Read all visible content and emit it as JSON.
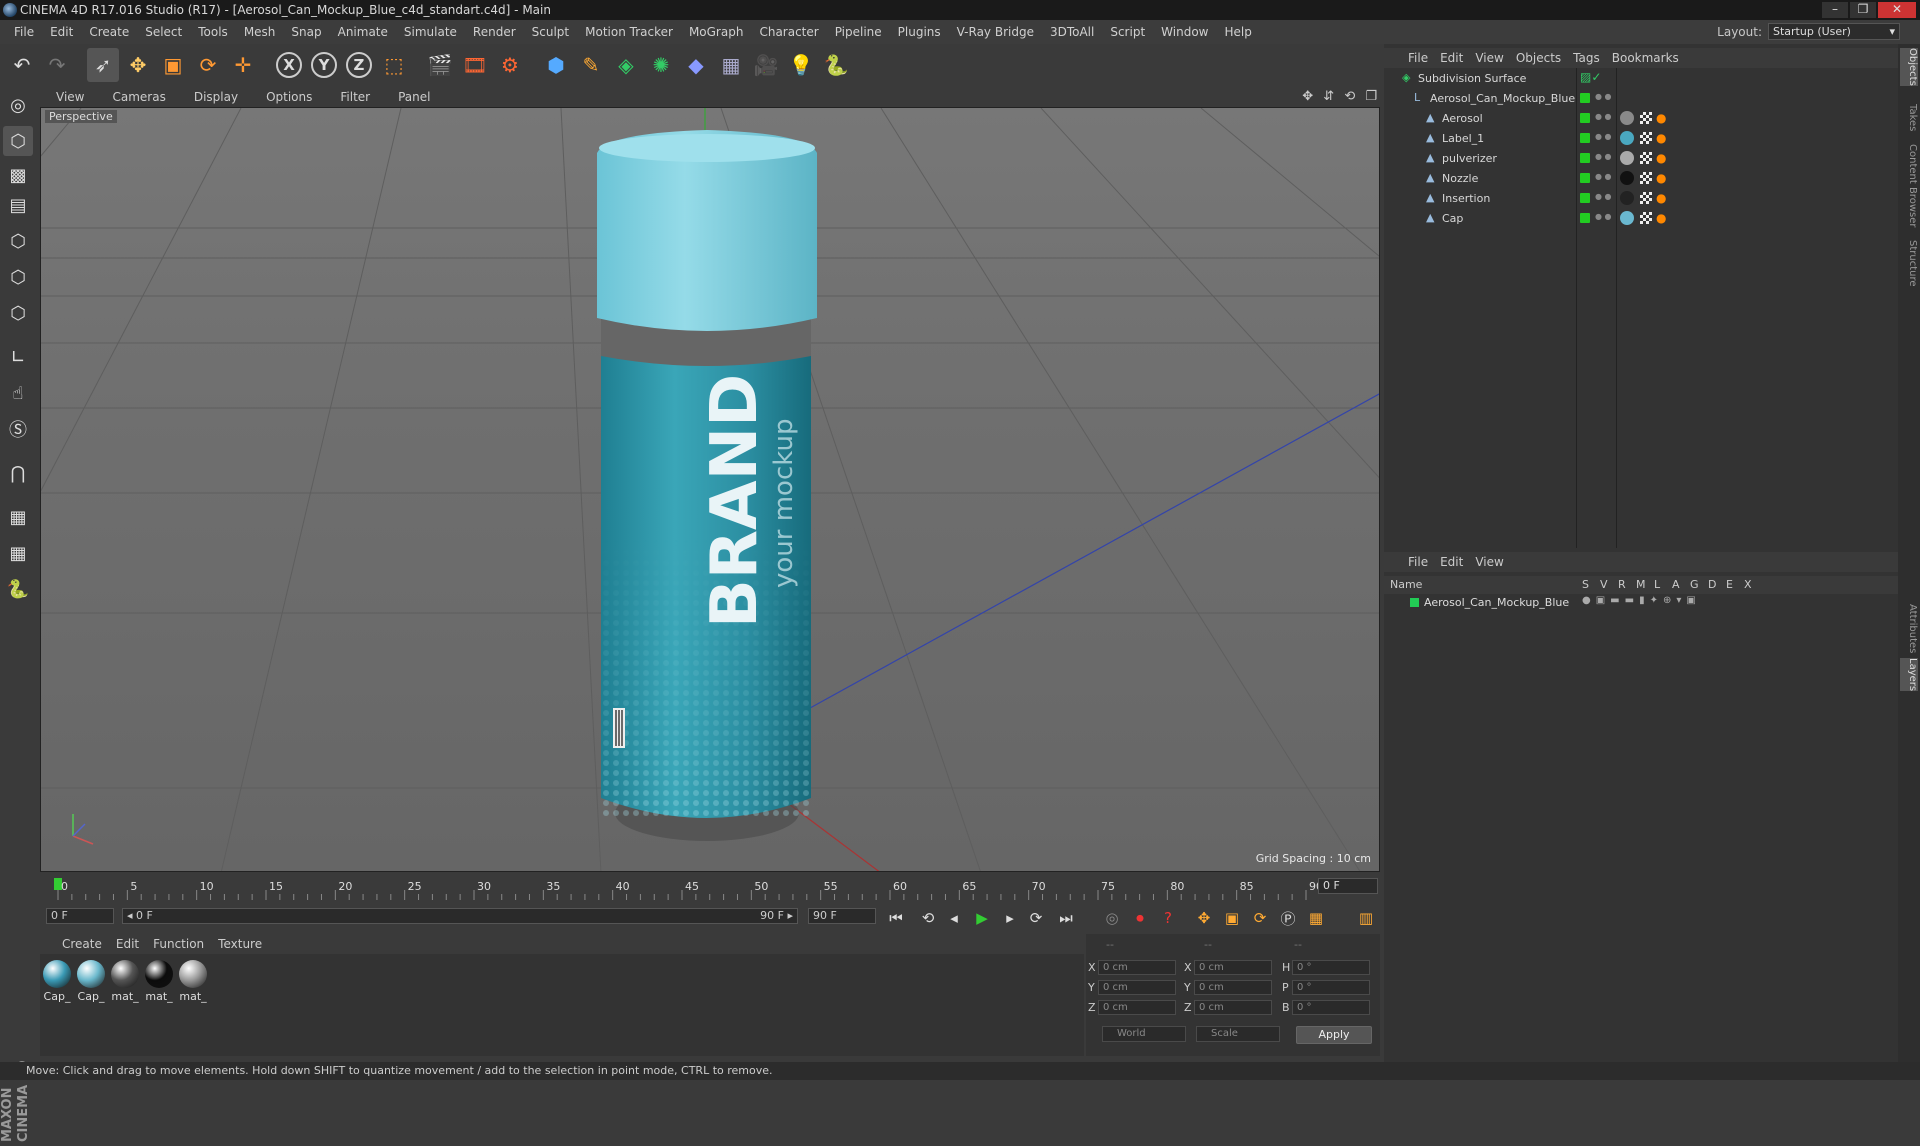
{
  "window": {
    "title": "CINEMA 4D R17.016 Studio (R17) - [Aerosol_Can_Mockup_Blue_c4d_standart.c4d] - Main"
  },
  "menu": [
    "File",
    "Edit",
    "Create",
    "Select",
    "Tools",
    "Mesh",
    "Snap",
    "Animate",
    "Simulate",
    "Render",
    "Sculpt",
    "Motion Tracker",
    "MoGraph",
    "Character",
    "Pipeline",
    "Plugins",
    "V-Ray Bridge",
    "3DToAll",
    "Script",
    "Window",
    "Help"
  ],
  "layout": {
    "label": "Layout:",
    "value": "Startup (User)"
  },
  "toolbar": {
    "axis_x": "X",
    "axis_y": "Y",
    "axis_z": "Z",
    "icons": [
      "undo-icon",
      "redo-icon",
      "select-icon",
      "move-icon",
      "scale-icon",
      "rotate-icon",
      "transform-icon",
      "axis-x",
      "axis-y",
      "axis-z",
      "coord-system-icon",
      "render-view-icon",
      "render-picture-viewer-icon",
      "edit-render-settings-icon",
      "cube-icon",
      "pen-icon",
      "subdivision-icon",
      "array-icon",
      "deformer-icon",
      "floor-icon",
      "camera-icon",
      "light-icon",
      "python-icon"
    ]
  },
  "viewport": {
    "menu": [
      "View",
      "Cameras",
      "Display",
      "Options",
      "Filter",
      "Panel"
    ],
    "label": "Perspective",
    "grid_spacing": "Grid Spacing : 10 cm",
    "nav_icons": "✥ ⇵ ⟲ ❐",
    "can": {
      "brand": "BRAND",
      "tagline": "your mockup"
    }
  },
  "objects_panel": {
    "menu": [
      "File",
      "Edit",
      "View",
      "Objects",
      "Tags",
      "Bookmarks"
    ],
    "items": [
      {
        "name": "Subdivision Surface",
        "level": 0
      },
      {
        "name": "Aerosol_Can_Mockup_Blue",
        "level": 1
      },
      {
        "name": "Aerosol",
        "level": 2,
        "mat_color": "#8a8a8a"
      },
      {
        "name": "Label_1",
        "level": 2,
        "mat_color": "#4aa8c0"
      },
      {
        "name": "pulverizer",
        "level": 2,
        "mat_color": "#aaaaaa"
      },
      {
        "name": "Nozzle",
        "level": 2,
        "mat_color": "#111111"
      },
      {
        "name": "Insertion",
        "level": 2,
        "mat_color": "#222222"
      },
      {
        "name": "Cap",
        "level": 2,
        "mat_color": "#6ab8d0"
      }
    ]
  },
  "layers_panel": {
    "menu": [
      "File",
      "Edit",
      "View"
    ],
    "columns": [
      "Name",
      "S",
      "V",
      "R",
      "M",
      "L",
      "A",
      "G",
      "D",
      "E",
      "X"
    ],
    "rows": [
      {
        "name": "Aerosol_Can_Mockup_Blue",
        "color": "#22cc55"
      }
    ]
  },
  "right_tabs": [
    "Objects",
    "Takes",
    "Content Browser",
    "Structure",
    "Attributes",
    "Layers"
  ],
  "timeline": {
    "ticks": [
      "0",
      "5",
      "10",
      "15",
      "20",
      "25",
      "30",
      "35",
      "40",
      "45",
      "50",
      "55",
      "60",
      "65",
      "70",
      "75",
      "80",
      "85",
      "90"
    ],
    "current_frame": "0 F",
    "start_field": "0 F",
    "range_start": "◂ 0 F",
    "range_end": "90 F ▸",
    "end_field": "90 F"
  },
  "materials_panel": {
    "menu": [
      "Create",
      "Edit",
      "Function",
      "Texture"
    ],
    "items": [
      {
        "label": "Cap_",
        "color": "#3a9ab5"
      },
      {
        "label": "Cap_",
        "color": "#6ab8cc"
      },
      {
        "label": "mat_",
        "color": "#555555"
      },
      {
        "label": "mat_",
        "color": "#0c0c0c"
      },
      {
        "label": "mat_",
        "color": "#9a9a9a"
      }
    ]
  },
  "coordinates": {
    "headers": [
      "--",
      "--",
      "--"
    ],
    "rows": [
      {
        "a": "X",
        "av": "0 cm",
        "b": "X",
        "bv": "0 cm",
        "c": "H",
        "cv": "0 °"
      },
      {
        "a": "Y",
        "av": "0 cm",
        "b": "Y",
        "bv": "0 cm",
        "c": "P",
        "cv": "0 °"
      },
      {
        "a": "Z",
        "av": "0 cm",
        "b": "Z",
        "bv": "0 cm",
        "c": "B",
        "cv": "0 °"
      }
    ],
    "world": "World",
    "scale": "Scale",
    "apply": "Apply"
  },
  "status": "Move: Click and drag to move elements. Hold down SHIFT to quantize movement / add to the selection in point mode, CTRL to remove.",
  "brand_logo": "MAXON CINEMA 4D"
}
